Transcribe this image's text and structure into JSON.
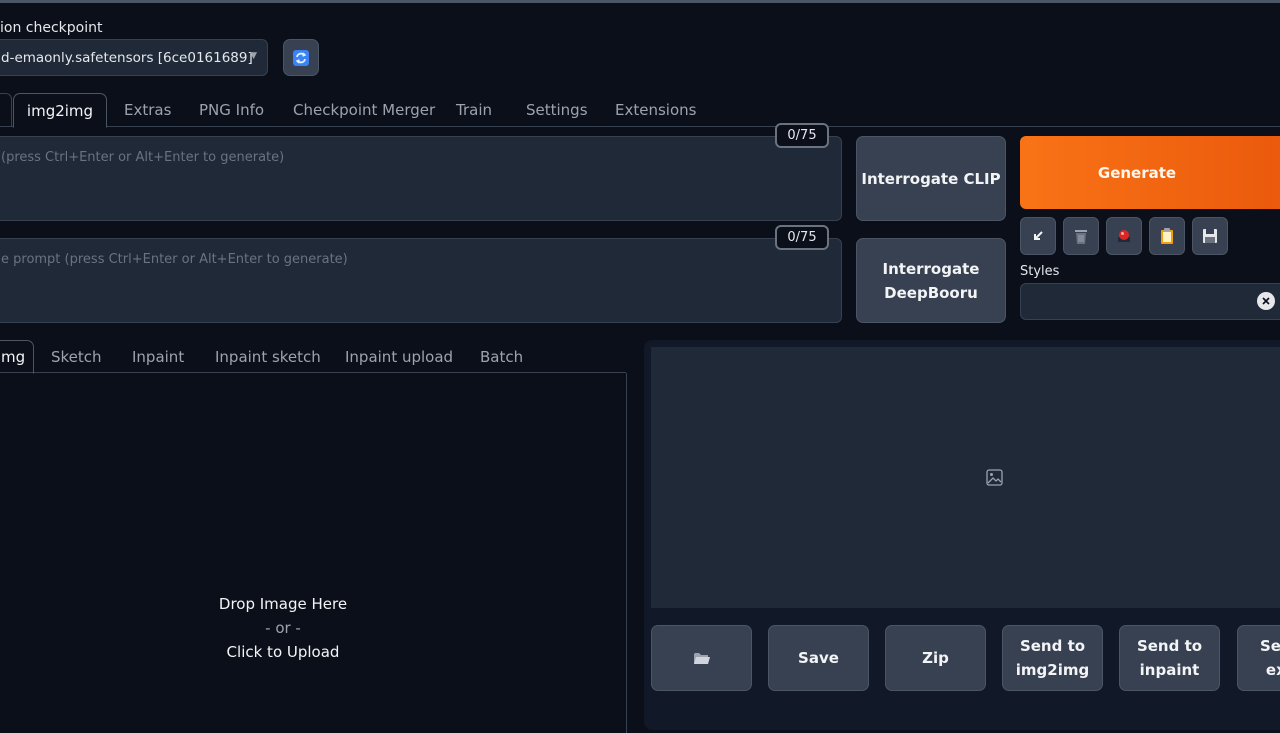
{
  "checkpoint": {
    "label": "ion checkpoint",
    "value": "d-emaonly.safetensors [6ce0161689]"
  },
  "main_tabs": [
    "img2img",
    "Extras",
    "PNG Info",
    "Checkpoint Merger",
    "Train",
    "Settings",
    "Extensions"
  ],
  "prompt": {
    "placeholder": "(press Ctrl+Enter or Alt+Enter to generate)",
    "token_count": "0/75"
  },
  "negative_prompt": {
    "placeholder": "e prompt (press Ctrl+Enter or Alt+Enter to generate)",
    "token_count": "0/75"
  },
  "interrogate": {
    "clip_label": "Interrogate CLIP",
    "deepbooru_line1": "Interrogate",
    "deepbooru_line2": "DeepBooru"
  },
  "generate_label": "Generate",
  "tool_icons": [
    "arrow-icon",
    "trash-icon",
    "red-dot-icon",
    "clipboard-icon",
    "save-icon"
  ],
  "styles_label": "Styles",
  "image_tabs": [
    "mg",
    "Sketch",
    "Inpaint",
    "Inpaint sketch",
    "Inpaint upload",
    "Batch"
  ],
  "drop": {
    "line1": "Drop Image Here",
    "line2": "- or -",
    "line3": "Click to Upload"
  },
  "output_buttons": {
    "save": "Save",
    "zip": "Zip",
    "send_img2img_1": "Send to",
    "send_img2img_2": "img2img",
    "send_inpaint_1": "Send to",
    "send_inpaint_2": "inpaint",
    "send_extras_1": "Sen",
    "send_extras_2": "ex"
  },
  "colors": {
    "generate": "#f97316",
    "background": "#0b0f19",
    "panel": "#1f2937"
  }
}
